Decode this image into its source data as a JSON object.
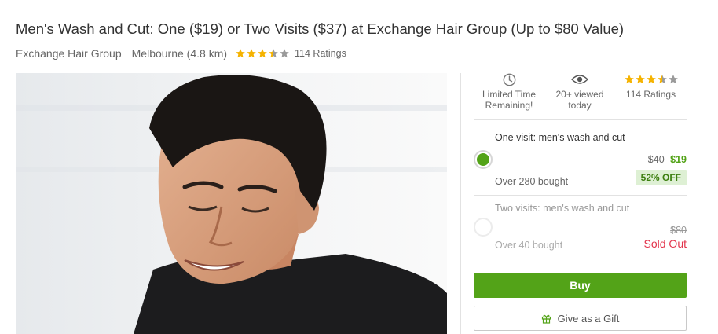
{
  "page": {
    "title": "Men's Wash and Cut: One ($19) or Two Visits ($37) at Exchange Hair Group (Up to $80 Value)",
    "merchant": "Exchange Hair Group",
    "location": "Melbourne (4.8 km)",
    "rating_value": 3.5,
    "rating_max": 5,
    "ratings_count_label": "114 Ratings"
  },
  "hero": {
    "icon": "man-smiling-photo"
  },
  "info_bar": {
    "time_label": "Limited Time Remaining!",
    "viewed_label": "20+ viewed today",
    "ratings_label": "114 Ratings",
    "rating_value": 3.5
  },
  "options": [
    {
      "title": "One visit: men's wash and cut",
      "old_price": "$40",
      "new_price": "$19",
      "bought": "Over 280 bought",
      "badge": "52% OFF",
      "selected": true
    },
    {
      "title": "Two visits: men's wash and cut",
      "old_price": "$80",
      "bought": "Over 40 bought",
      "status": "Sold Out",
      "selected": false
    }
  ],
  "actions": {
    "buy_label": "Buy",
    "gift_label": "Give as a Gift"
  },
  "colors": {
    "accent_green": "#53a318",
    "star_gold": "#f5b301",
    "sold_out_red": "#e3344c"
  }
}
